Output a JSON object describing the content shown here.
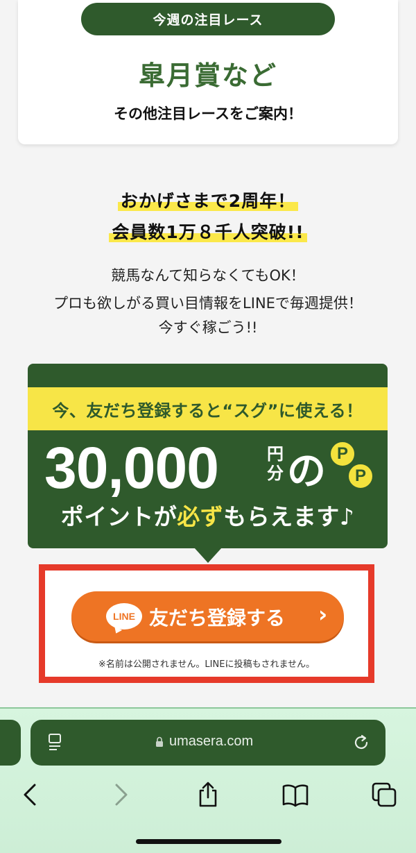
{
  "race": {
    "pill_label": "今週の注目レース",
    "title": "皐月賞など",
    "subtitle": "その他注目レースをご案内！"
  },
  "anniversary": {
    "line1": "おかげさまで2周年！",
    "line2": "会員数1万８千人突破!!"
  },
  "description": {
    "line1": "競馬なんて知らなくてもOK！",
    "line2": "プロも欲しがる買い目情報をLINEで毎週提供！",
    "line3": "今すぐ稼ごう!!"
  },
  "promo": {
    "banner": "今、友だち登録すると“スグ”に使える！",
    "amount": "30,000",
    "unit_top": "円",
    "unit_bottom": "分",
    "particle": "の",
    "coin_label": "P",
    "points_pre": "ポイントが",
    "points_highlight": "必ず",
    "points_post": "もらえます♪",
    "colors": {
      "green": "#2f5a2c",
      "yellow": "#f7e547"
    }
  },
  "cta": {
    "line_icon_text": "LINE",
    "label": "友だち登録する",
    "chevron": "›",
    "note": "※名前は公開されません。LINEに投稿もされません。",
    "colors": {
      "button": "#ee7424",
      "frame": "#e63a2a"
    }
  },
  "browser": {
    "url": "umasera.com",
    "icons": [
      "reader-icon",
      "lock-icon",
      "reload-icon",
      "back-icon",
      "forward-icon",
      "share-icon",
      "bookmarks-icon",
      "tabs-icon"
    ]
  }
}
